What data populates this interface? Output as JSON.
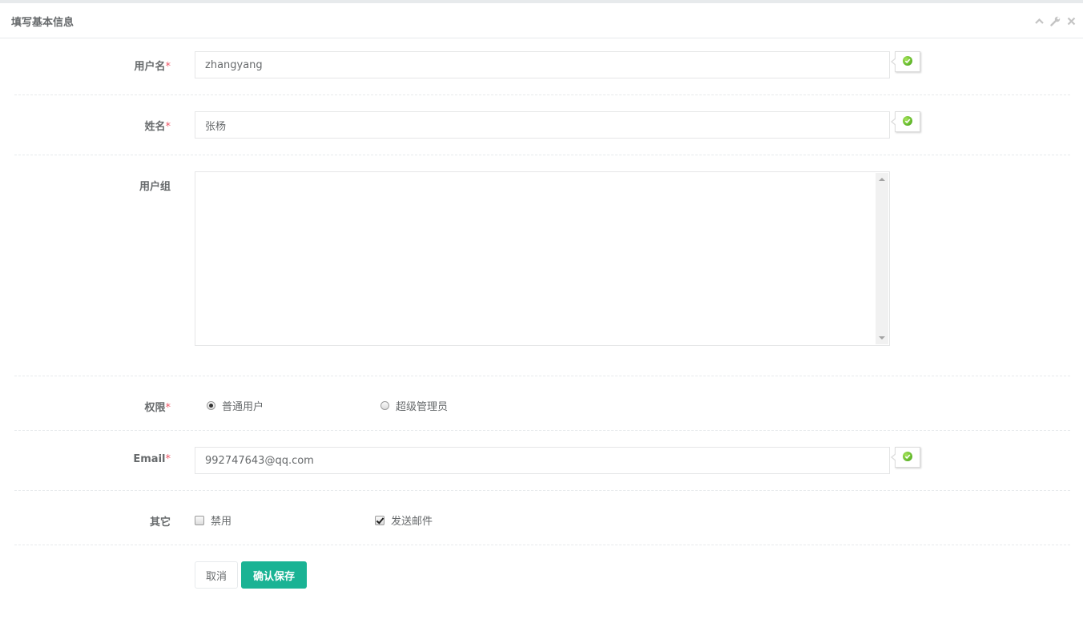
{
  "panel": {
    "title": "填写基本信息",
    "tools": [
      "collapse-icon",
      "wrench-icon",
      "close-icon"
    ]
  },
  "form": {
    "username": {
      "label": "用户名",
      "required": "*",
      "value": "zhangyang"
    },
    "fullname": {
      "label": "姓名",
      "required": "*",
      "value": "张杨"
    },
    "group": {
      "label": "用户组"
    },
    "permission": {
      "label": "权限",
      "required": "*",
      "options": [
        {
          "label": "普通用户",
          "selected": true
        },
        {
          "label": "超级管理员",
          "selected": false
        }
      ]
    },
    "email": {
      "label": "Email",
      "required": "*",
      "value": "992747643@qq.com"
    },
    "other": {
      "label": "其它",
      "options": [
        {
          "label": "禁用",
          "checked": false
        },
        {
          "label": "发送邮件",
          "checked": true
        }
      ]
    }
  },
  "buttons": {
    "cancel": "取消",
    "save": "确认保存"
  },
  "colors": {
    "primary": "#1ab394",
    "required": "#ed5565",
    "valid": "#3d9e13"
  }
}
